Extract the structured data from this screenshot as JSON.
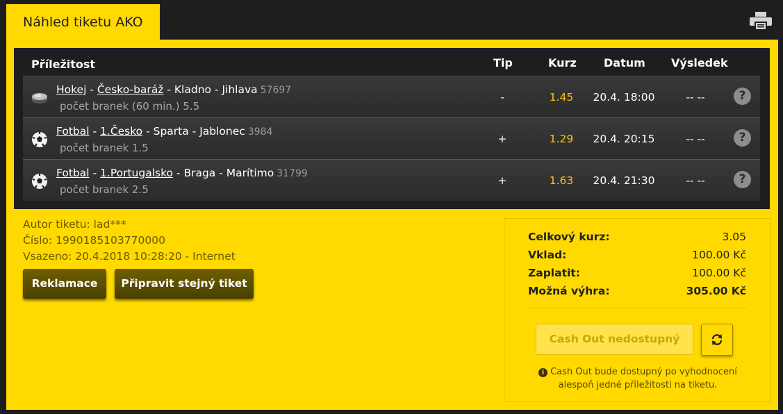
{
  "tab": {
    "title": "Náhled tiketu AKO"
  },
  "table": {
    "headers": {
      "event": "Příležitost",
      "tip": "Tip",
      "kurz": "Kurz",
      "datum": "Datum",
      "vysledek": "Výsledek"
    },
    "rows": [
      {
        "sport_icon": "hockey-puck-icon",
        "sport": "Hokej",
        "league": "Česko-baráž",
        "match": "Kladno - Jihlava",
        "id": "57697",
        "market": "počet branek (60 min.) 5.5",
        "tip": "-",
        "odds": "1.45",
        "date": "20.4. 18:00",
        "result": "-- --"
      },
      {
        "sport_icon": "soccer-ball-icon",
        "sport": "Fotbal",
        "league": "1.Česko",
        "match": "Sparta - Jablonec",
        "id": "3984",
        "market": "počet branek 1.5",
        "tip": "+",
        "odds": "1.29",
        "date": "20.4. 20:15",
        "result": "-- --"
      },
      {
        "sport_icon": "soccer-ball-icon",
        "sport": "Fotbal",
        "league": "1.Portugalsko",
        "match": "Braga - Marítimo",
        "id": "31799",
        "market": "počet branek 2.5",
        "tip": "+",
        "odds": "1.63",
        "date": "20.4. 21:30",
        "result": "-- --"
      }
    ],
    "sep": " - ",
    "help": "?"
  },
  "ticket": {
    "author": "Autor tiketu: lad***",
    "number": "Číslo: 1990185103770000",
    "placed": "Vsazeno: 20.4.2018 10:28:20 - Internet"
  },
  "buttons": {
    "reklamace": "Reklamace",
    "same_ticket": "Připravit stejný tiket"
  },
  "summary": {
    "total_odds_label": "Celkový kurz:",
    "total_odds": "3.05",
    "stake_label": "Vklad:",
    "stake": "100.00 Kč",
    "pay_label": "Zaplatit:",
    "pay": "100.00 Kč",
    "win_label": "Možná výhra:",
    "win": "305.00 Kč",
    "cashout": "Cash Out nedostupný",
    "note_line1": "Cash Out bude dostupný po vyhodnocení",
    "note_line2": "alespoň jedné příležitosti na tiketu.",
    "info_mark": "i"
  },
  "colors": {
    "accent": "#ffd900",
    "odds": "#ffc20e",
    "dark": "#1e1e1e"
  }
}
